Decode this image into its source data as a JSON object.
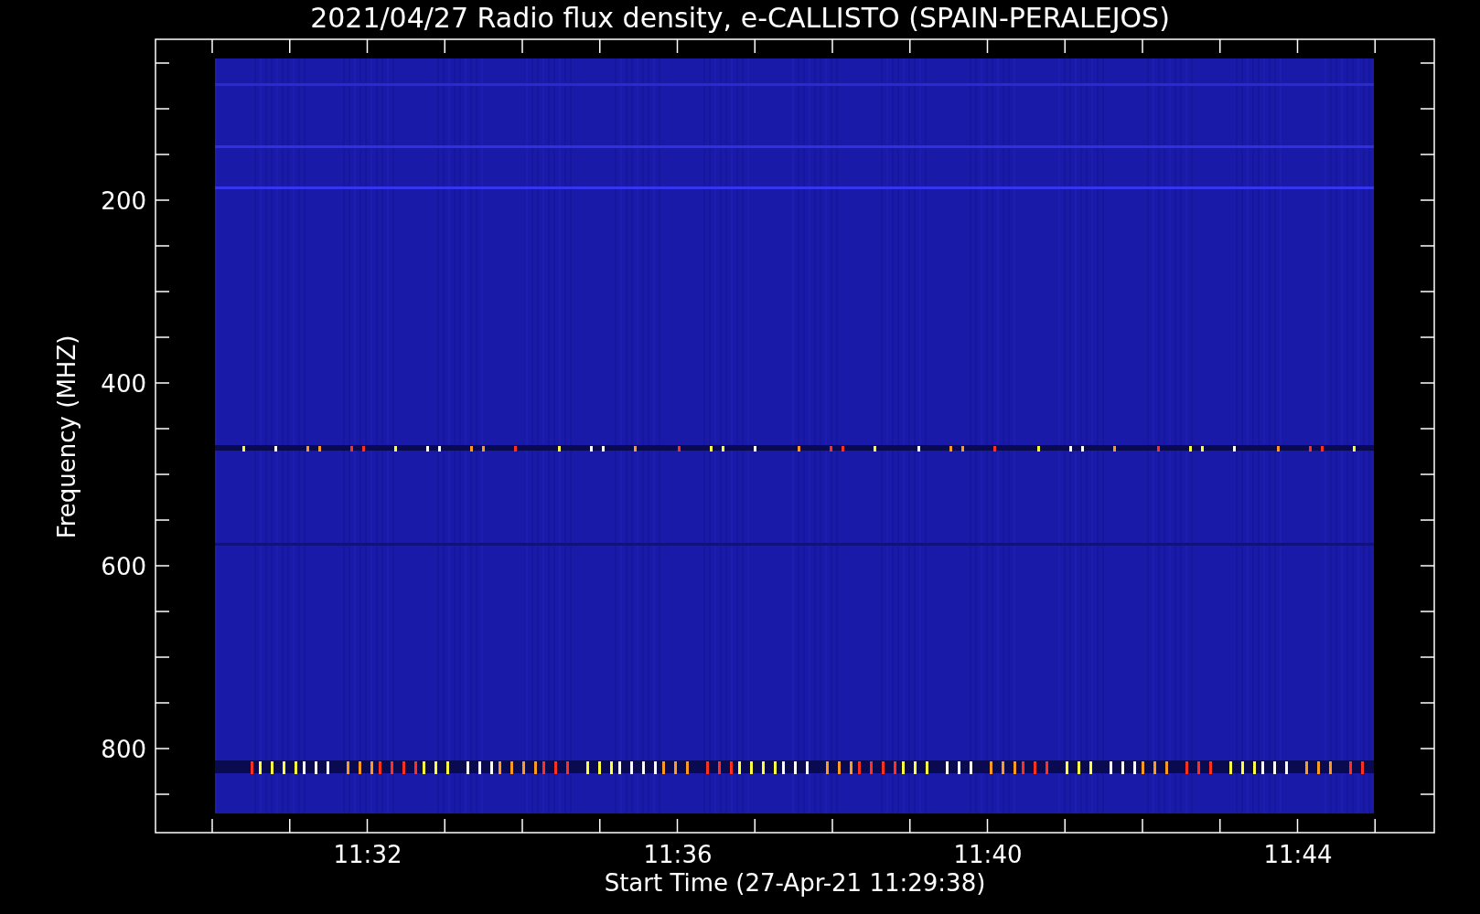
{
  "title": "2021/04/27  Radio flux density, e-CALLISTO (SPAIN-PERALEJOS)",
  "ylabel": "Frequency (MHZ)",
  "xlabel": "Start Time (27-Apr-21 11:29:38)",
  "yticks": [
    "200",
    "400",
    "600",
    "800"
  ],
  "xticks": [
    "11:32",
    "11:36",
    "11:40",
    "11:44"
  ]
}
